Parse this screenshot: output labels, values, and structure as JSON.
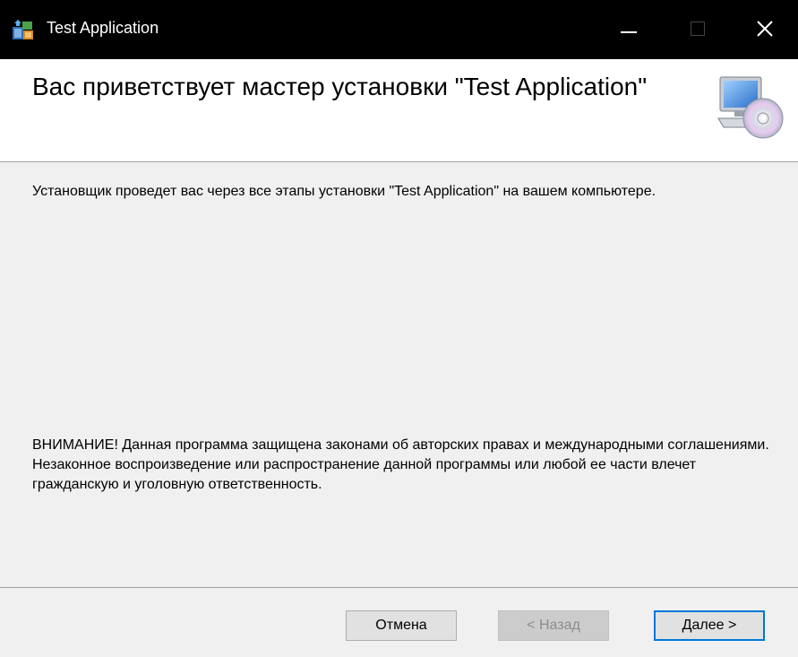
{
  "window": {
    "title": "Test Application",
    "controls": {
      "minimize": "minimize",
      "maximize": "maximize",
      "close": "close"
    }
  },
  "banner": {
    "title": "Вас приветствует мастер установки \"Test Application\"",
    "icon": "computer-cd-icon"
  },
  "content": {
    "intro": "Установщик проведет вас через все этапы установки \"Test Application\" на вашем компьютере.",
    "warning": "ВНИМАНИЕ! Данная программа защищена законами об авторских правах и международными соглашениями. Незаконное воспроизведение или распространение данной программы или любой ее части влечет гражданскую и уголовную ответственность."
  },
  "buttons": {
    "cancel": "Отмена",
    "back": "< Назад",
    "next": "Далее >"
  },
  "colors": {
    "accent": "#0078d7",
    "titlebar": "#000000",
    "dialog_bg": "#f0f0f0"
  }
}
